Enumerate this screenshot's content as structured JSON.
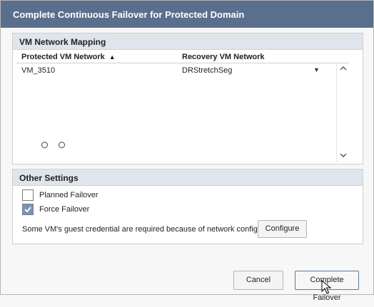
{
  "dialog": {
    "title": "Complete Continuous Failover for Protected Domain"
  },
  "network_mapping": {
    "heading": "VM Network Mapping",
    "columns": [
      "Protected VM Network",
      "Recovery VM Network"
    ],
    "sort_icon": "sort-ascending-icon",
    "rows": [
      {
        "protected": "VM_3510",
        "recovery": "DRStretchSeg"
      }
    ],
    "page_dots": 2
  },
  "other_settings": {
    "heading": "Other Settings",
    "options": [
      {
        "label": "Planned Failover",
        "checked": false
      },
      {
        "label": "Force Failover",
        "checked": true
      }
    ],
    "credential_note": "Some VM's guest credential are required because of network configuration:",
    "configure_label": "Configure"
  },
  "footer": {
    "cancel_label": "Cancel",
    "complete_label": "Complete Failover"
  },
  "colors": {
    "titlebar": "#5a6f8d",
    "section_header": "#dfe5ec",
    "checkbox_checked": "#7e94ae",
    "primary_border": "#5b7aa0"
  }
}
